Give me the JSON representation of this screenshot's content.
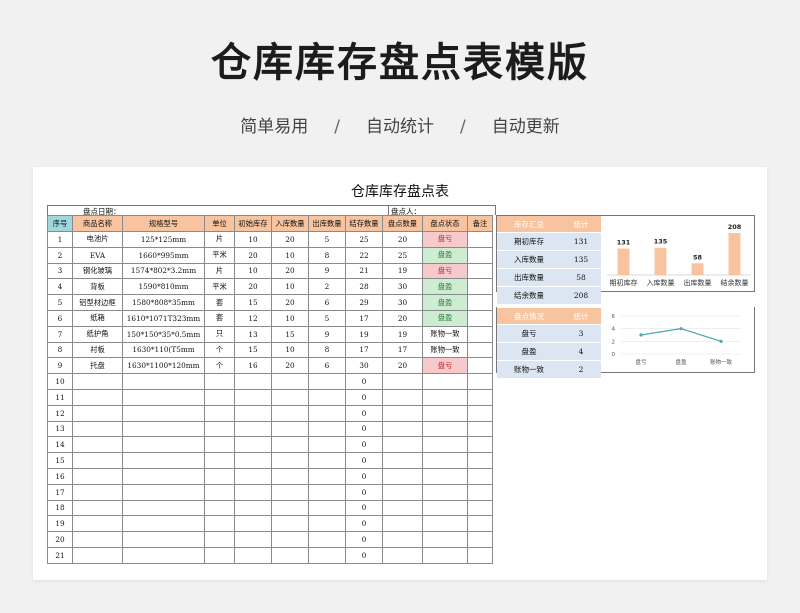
{
  "header": {
    "title": "仓库库存盘点表模版",
    "subtitle_items": [
      "简单易用",
      "自动统计",
      "自动更新"
    ],
    "subtitle_sep": "/"
  },
  "sheet": {
    "title": "仓库库存盘点表",
    "date_label": "盘点日期：",
    "person_label": "盘点人：",
    "columns": [
      "序号",
      "商品名称",
      "规格型号",
      "单位",
      "初始库存",
      "入库数量",
      "出库数量",
      "结存数量",
      "盘点数量",
      "盘点状态",
      "备注"
    ],
    "rows": [
      [
        "1",
        "电池片",
        "125*125mm",
        "片",
        "10",
        "20",
        "5",
        "25",
        "20",
        "盘亏",
        ""
      ],
      [
        "2",
        "EVA",
        "1660*995mm",
        "平米",
        "20",
        "10",
        "8",
        "22",
        "25",
        "盘盈",
        ""
      ],
      [
        "3",
        "钢化玻璃",
        "1574*802*3.2mm",
        "片",
        "10",
        "20",
        "9",
        "21",
        "19",
        "盘亏",
        ""
      ],
      [
        "4",
        "背板",
        "1590*810mm",
        "平米",
        "20",
        "10",
        "2",
        "28",
        "30",
        "盘盈",
        ""
      ],
      [
        "5",
        "铝型材边框",
        "1580*808*35mm",
        "套",
        "15",
        "20",
        "6",
        "29",
        "30",
        "盘盈",
        ""
      ],
      [
        "6",
        "纸箱",
        "1610*1071T323mm",
        "套",
        "12",
        "10",
        "5",
        "17",
        "20",
        "盘盈",
        ""
      ],
      [
        "7",
        "纸护角",
        "150*150*35*0.5mm",
        "只",
        "13",
        "15",
        "9",
        "19",
        "19",
        "账物一致",
        ""
      ],
      [
        "8",
        "衬板",
        "1630*110(T5mm",
        "个",
        "15",
        "10",
        "8",
        "17",
        "17",
        "账物一致",
        ""
      ],
      [
        "9",
        "托盘",
        "1630*1100*120mm",
        "个",
        "16",
        "20",
        "6",
        "30",
        "20",
        "盘亏",
        ""
      ],
      [
        "10",
        "",
        "",
        "",
        "",
        "",
        "",
        "0",
        "",
        "",
        ""
      ],
      [
        "11",
        "",
        "",
        "",
        "",
        "",
        "",
        "0",
        "",
        "",
        ""
      ],
      [
        "12",
        "",
        "",
        "",
        "",
        "",
        "",
        "0",
        "",
        "",
        ""
      ],
      [
        "13",
        "",
        "",
        "",
        "",
        "",
        "",
        "0",
        "",
        "",
        ""
      ],
      [
        "14",
        "",
        "",
        "",
        "",
        "",
        "",
        "0",
        "",
        "",
        ""
      ],
      [
        "15",
        "",
        "",
        "",
        "",
        "",
        "",
        "0",
        "",
        "",
        ""
      ],
      [
        "16",
        "",
        "",
        "",
        "",
        "",
        "",
        "0",
        "",
        "",
        ""
      ],
      [
        "17",
        "",
        "",
        "",
        "",
        "",
        "",
        "0",
        "",
        "",
        ""
      ],
      [
        "18",
        "",
        "",
        "",
        "",
        "",
        "",
        "0",
        "",
        "",
        ""
      ],
      [
        "19",
        "",
        "",
        "",
        "",
        "",
        "",
        "0",
        "",
        "",
        ""
      ],
      [
        "20",
        "",
        "",
        "",
        "",
        "",
        "",
        "0",
        "",
        "",
        ""
      ],
      [
        "21",
        "",
        "",
        "",
        "",
        "",
        "",
        "0",
        "",
        "",
        ""
      ]
    ],
    "status_colors": {
      "盘亏": "#f6c9cc",
      "盘盈": "#cdecd1"
    }
  },
  "stock_summary": {
    "headers": [
      "库存汇总",
      "统计"
    ],
    "rows": [
      {
        "label": "期初库存",
        "value": "131"
      },
      {
        "label": "入库数量",
        "value": "135"
      },
      {
        "label": "出库数量",
        "value": "58"
      },
      {
        "label": "结余数量",
        "value": "208"
      }
    ]
  },
  "check_summary": {
    "headers": [
      "盘点情况",
      "统计"
    ],
    "rows": [
      {
        "label": "盘亏",
        "value": "3"
      },
      {
        "label": "盘盈",
        "value": "4"
      },
      {
        "label": "账物一致",
        "value": "2"
      }
    ]
  },
  "chart_data": [
    {
      "type": "bar",
      "categories": [
        "期初库存",
        "入库数量",
        "出库数量",
        "结余数量"
      ],
      "values": [
        131,
        135,
        58,
        208
      ],
      "ylim": [
        0,
        208
      ],
      "color": "#f8c49f",
      "data_labels": true,
      "grid": false
    },
    {
      "type": "line",
      "categories": [
        "盘亏",
        "盘盈",
        "账物一致"
      ],
      "values": [
        3,
        4,
        2
      ],
      "ylim": [
        0,
        6
      ],
      "yticks": [
        "0",
        "2",
        "4",
        "6"
      ],
      "color": "#4aa7b3",
      "grid": true
    }
  ]
}
